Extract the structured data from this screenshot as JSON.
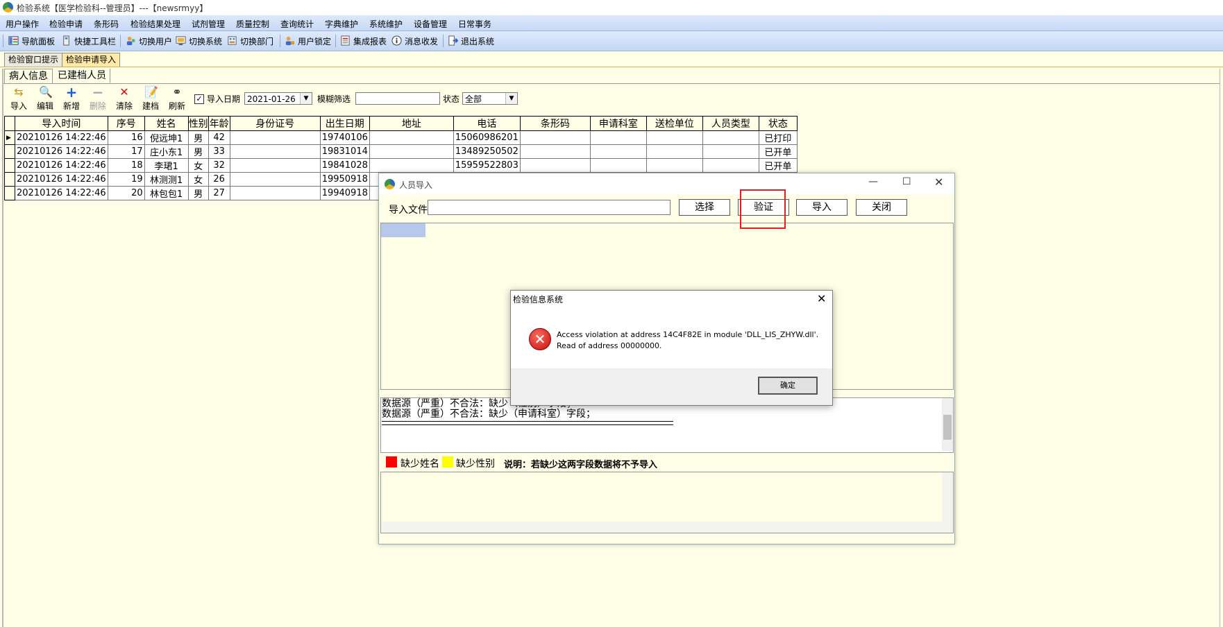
{
  "window": {
    "title": "检验系统【医学检验科--管理员】---【newsrmyy】"
  },
  "menu": [
    "用户操作",
    "检验申请",
    "条形码",
    "检验结果处理",
    "试剂管理",
    "质量控制",
    "查询统计",
    "字典维护",
    "系统维护",
    "设备管理",
    "日常事务"
  ],
  "toolbar": [
    "导航面板",
    "快捷工具栏",
    "切换用户",
    "切换系统",
    "切换部门",
    "用户锁定",
    "集成报表",
    "消息收发",
    "退出系统"
  ],
  "tabs": [
    "检验窗口提示",
    "检验申请导入"
  ],
  "subtabs": [
    "病人信息",
    "已建档人员"
  ],
  "actions": [
    "导入",
    "编辑",
    "新增",
    "删除",
    "清除",
    "建档",
    "刷新"
  ],
  "filter": {
    "date_label": "导入日期",
    "date_value": "2021-01-26",
    "fuzzy_label": "模糊筛选",
    "status_label": "状态",
    "status_value": "全部"
  },
  "table": {
    "columns": [
      "导入时间",
      "序号",
      "姓名",
      "性别",
      "年龄",
      "身份证号",
      "出生日期",
      "地址",
      "电话",
      "条形码",
      "申请科室",
      "送检单位",
      "人员类型",
      "状态"
    ],
    "rows": [
      [
        "20210126 14:22:46",
        "16",
        "倪远坤1",
        "男",
        "42",
        "",
        "19740106",
        "",
        "15060986201",
        "",
        "",
        "",
        "",
        "已打印"
      ],
      [
        "20210126 14:22:46",
        "17",
        "庄小东1",
        "男",
        "33",
        "",
        "19831014",
        "",
        "13489250502",
        "",
        "",
        "",
        "",
        "已开单"
      ],
      [
        "20210126 14:22:46",
        "18",
        "李珺1",
        "女",
        "32",
        "",
        "19841028",
        "",
        "15959522803",
        "",
        "",
        "",
        "",
        "已开单"
      ],
      [
        "20210126 14:22:46",
        "19",
        "林测测1",
        "女",
        "26",
        "",
        "19950918",
        "",
        "",
        "",
        "",
        "",
        "",
        ""
      ],
      [
        "20210126 14:22:46",
        "20",
        "林包包1",
        "男",
        "27",
        "",
        "19940918",
        "",
        "",
        "",
        "",
        "",
        "",
        ""
      ]
    ]
  },
  "import_dialog": {
    "title": "人员导入",
    "file_label": "导入文件",
    "buttons": {
      "select": "选择",
      "verify": "验证",
      "import": "导入",
      "close": "关闭"
    },
    "log_lines": [
      "数据源（严重）不合法：缺少（性别）字段；",
      "数据源（严重）不合法：缺少（申请科室）字段；"
    ],
    "legend": {
      "missing_name": "缺少姓名",
      "missing_gender": "缺少性别",
      "note": "说明：若缺少这两字段数据将不予导入"
    }
  },
  "message_box": {
    "title": "检验信息系统",
    "line1": "Access violation at address 14C4F82E in module 'DLL_LIS_ZHYW.dll'.",
    "line2": "Read of address 00000000.",
    "ok": "确定"
  },
  "colors": {
    "background": "#fefee6",
    "active_tab": "#ffe9a6",
    "highlight": "#e02020"
  }
}
